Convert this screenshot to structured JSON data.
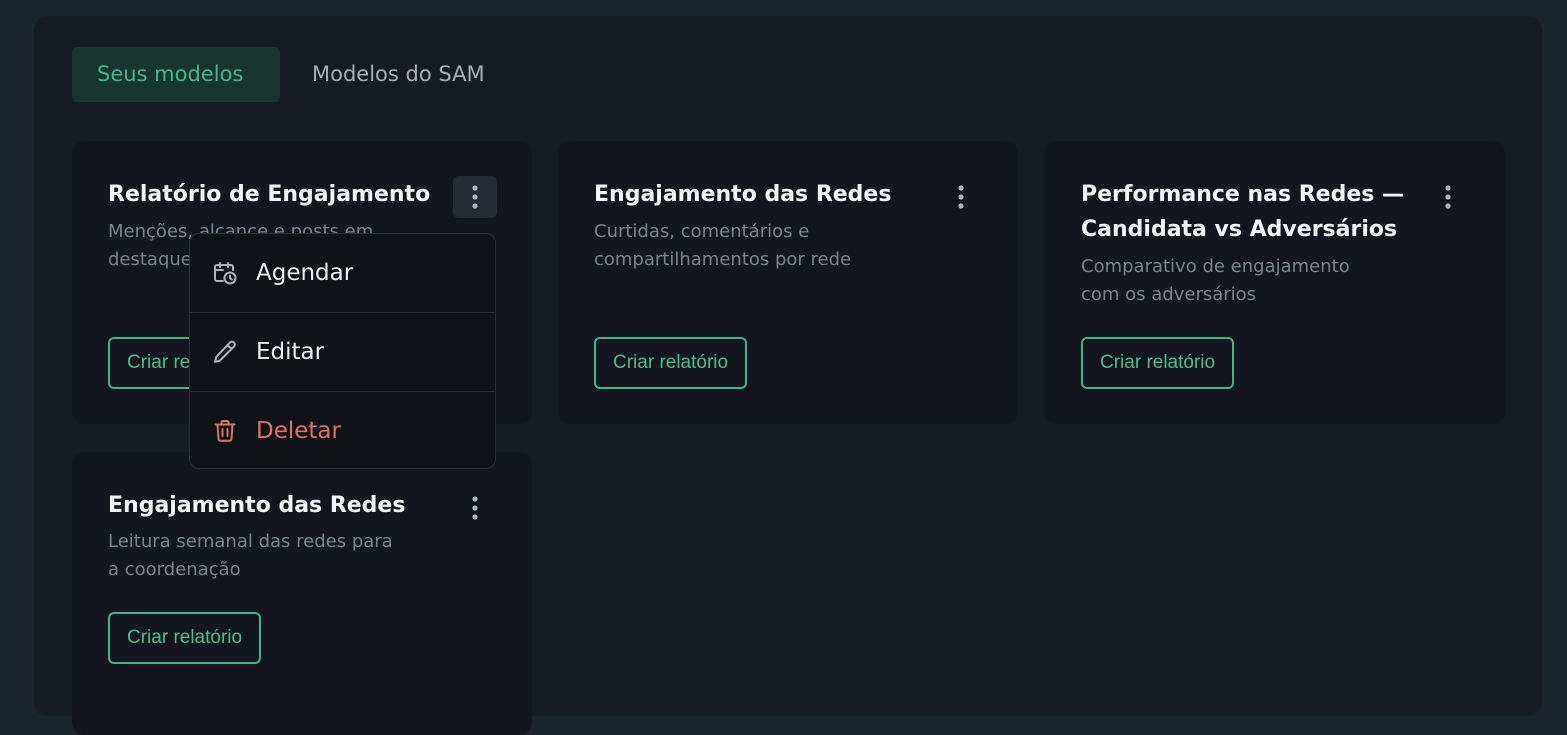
{
  "tabs": [
    {
      "label": "Seus modelos",
      "active": true
    },
    {
      "label": "Modelos do SAM",
      "active": false
    }
  ],
  "cards": [
    {
      "title": "Relatório de Engajamento",
      "desc_line1": "Menções, alcance e posts em",
      "desc_line2": "destaque",
      "button": "Criar relatório"
    },
    {
      "title": "Engajamento das Redes",
      "desc_line1": "Curtidas, comentários e",
      "desc_line2": "compartilhamentos por rede",
      "button": "Criar relatório"
    },
    {
      "title_line1": "Performance nas Redes —",
      "title_line2": "Candidata vs Adversários",
      "desc_line1": "Comparativo de engajamento",
      "desc_line2": "com os adversários",
      "button": "Criar relatório"
    },
    {
      "title": "Engajamento das Redes",
      "desc_line1": "Leitura semanal das redes para",
      "desc_line2": "a coordenação",
      "button": "Criar relatório"
    }
  ],
  "context_menu": {
    "items": [
      {
        "label": "Agendar",
        "icon": "calendar-clock-icon"
      },
      {
        "label": "Editar",
        "icon": "pencil-icon"
      },
      {
        "label": "Deletar",
        "icon": "trash-icon",
        "color": "#e0706c"
      }
    ]
  },
  "colors": {
    "accent": "#43b88c",
    "danger": "#e0706c",
    "background": "#1d252c"
  }
}
